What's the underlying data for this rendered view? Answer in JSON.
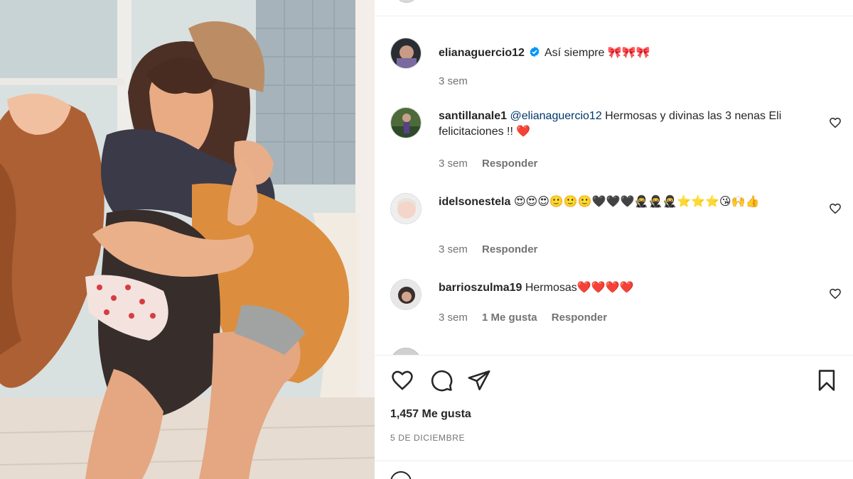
{
  "post": {
    "author": "elianaguercio12",
    "caption": "Así siempre 🎀🎀🎀",
    "age": "3 sem"
  },
  "comments": [
    {
      "username": "santillanale1",
      "mention": "@elianaguercio12",
      "text": " Hermosas y divinas las 3 nenas Eli felicitaciones !! ❤️",
      "age": "3 sem",
      "reply_label": "Responder"
    },
    {
      "username": "idelsonestela",
      "text": "😍😍😍🙂🙂🙂🖤🖤🖤🥷🥷🥷⭐⭐⭐😘🙌👍",
      "age": "3 sem",
      "reply_label": "Responder"
    },
    {
      "username": "barrioszulma19",
      "text": "Hermosas❤️❤️❤️❤️",
      "age": "3 sem",
      "likes_label": "1 Me gusta",
      "reply_label": "Responder"
    }
  ],
  "likes_count": "1,457 Me gusta",
  "post_date": "5 DE DICIEMBRE",
  "icons": {
    "like": "heart-icon",
    "comment": "comment-icon",
    "share": "share-icon",
    "save": "bookmark-icon",
    "verified": "verified-badge-icon",
    "comment_like": "heart-icon"
  },
  "colors": {
    "text": "#262626",
    "secondary": "#737373",
    "mention": "#00376b",
    "verified": "#0095f6",
    "divider": "#efefef"
  }
}
